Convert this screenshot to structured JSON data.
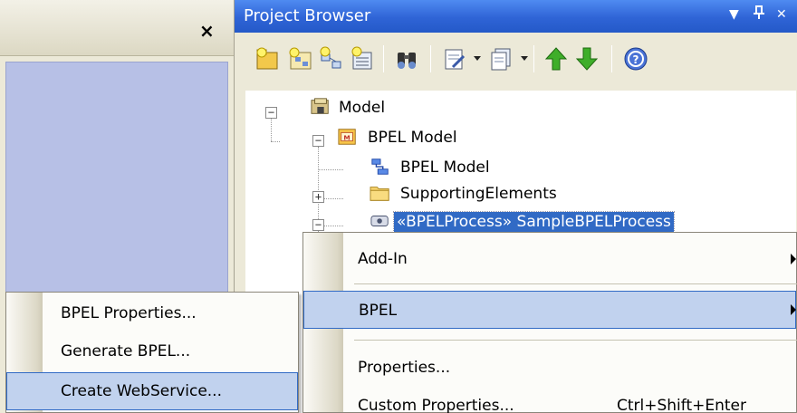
{
  "browser": {
    "title": "Project Browser",
    "dropdown_glyph": "▼",
    "pin_glyph": "ᵖ",
    "close_glyph": "✕"
  },
  "left_panel": {
    "close_glyph": "×"
  },
  "toolbar": {
    "buttons": [
      {
        "icon": "new-package-icon"
      },
      {
        "icon": "new-diagram-icon"
      },
      {
        "icon": "new-element-icon"
      },
      {
        "icon": "new-child-icon"
      },
      {
        "icon": "find-icon"
      },
      {
        "icon": "document-icon"
      },
      {
        "icon": "properties-icon"
      },
      {
        "icon": "move-up-icon"
      },
      {
        "icon": "move-down-icon"
      },
      {
        "icon": "help-icon"
      }
    ]
  },
  "tree": {
    "nodes": [
      {
        "label": "Model",
        "icon": "model-root-icon"
      },
      {
        "label": "BPEL Model",
        "icon": "bpel-package-icon"
      },
      {
        "label": "BPEL Model",
        "icon": "bpel-diagram-icon"
      },
      {
        "label": "SupportingElements",
        "icon": "folder-icon"
      },
      {
        "label": "«BPELProcess» SampleBPELProcess",
        "icon": "bpel-process-icon"
      }
    ]
  },
  "context_menu": {
    "items": [
      {
        "label": "Add-In",
        "has_submenu": true
      },
      {
        "label": "BPEL",
        "has_submenu": true
      },
      {
        "label": "Properties..."
      },
      {
        "label": "Custom Properties...",
        "shortcut": "Ctrl+Shift+Enter"
      }
    ]
  },
  "bpel_submenu": {
    "items": [
      {
        "label": "BPEL Properties..."
      },
      {
        "label": "Generate BPEL..."
      },
      {
        "label": "Create WebService..."
      }
    ]
  },
  "colors": {
    "title_bar": "#2f64d6",
    "selection": "#316ac5",
    "menu_hover": "#c1d2ee",
    "left_panel_body": "#b7c0e6"
  }
}
